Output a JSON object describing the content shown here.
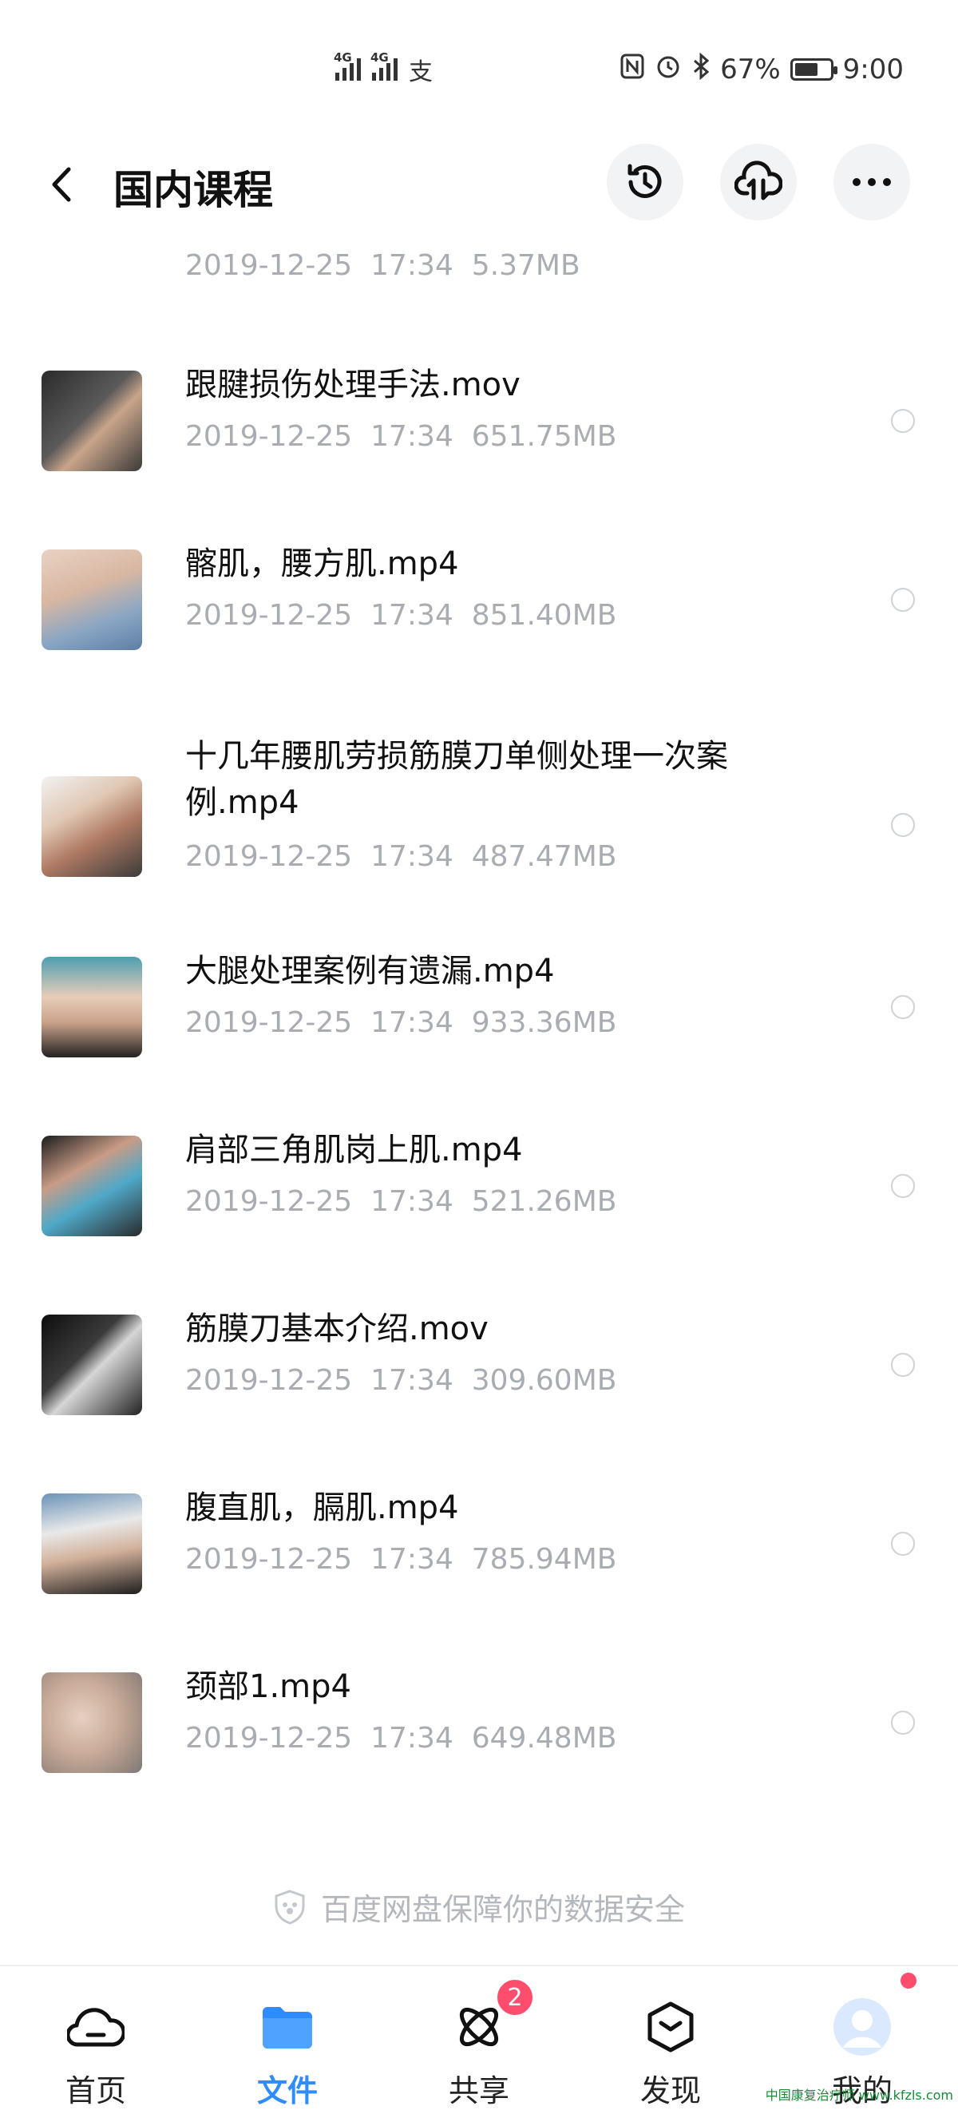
{
  "status_bar": {
    "network1": "4G",
    "network2": "4G",
    "battery_percent": "67%",
    "time": "9:00"
  },
  "header": {
    "title": "国内课程"
  },
  "files": [
    {
      "name": "",
      "date": "2019-12-25",
      "time": "17:34",
      "size": "5.37MB"
    },
    {
      "name": "跟腱损伤处理手法.mov",
      "date": "2019-12-25",
      "time": "17:34",
      "size": "651.75MB"
    },
    {
      "name": "髂肌，腰方肌.mp4",
      "date": "2019-12-25",
      "time": "17:34",
      "size": "851.40MB"
    },
    {
      "name": "十几年腰肌劳损筋膜刀单侧处理一次案例.mp4",
      "date": "2019-12-25",
      "time": "17:34",
      "size": "487.47MB"
    },
    {
      "name": "大腿处理案例有遗漏.mp4",
      "date": "2019-12-25",
      "time": "17:34",
      "size": "933.36MB"
    },
    {
      "name": "肩部三角肌岗上肌.mp4",
      "date": "2019-12-25",
      "time": "17:34",
      "size": "521.26MB"
    },
    {
      "name": "筋膜刀基本介绍.mov",
      "date": "2019-12-25",
      "time": "17:34",
      "size": "309.60MB"
    },
    {
      "name": "腹直肌，膈肌.mp4",
      "date": "2019-12-25",
      "time": "17:34",
      "size": "785.94MB"
    },
    {
      "name": "颈部1.mp4",
      "date": "2019-12-25",
      "time": "17:34",
      "size": "649.48MB"
    }
  ],
  "footer_note": "百度网盘保障你的数据安全",
  "tabbar": {
    "tabs": [
      {
        "label": "首页",
        "icon": "cloud-icon"
      },
      {
        "label": "文件",
        "icon": "folder-icon"
      },
      {
        "label": "共享",
        "icon": "atom-icon",
        "badge": "2"
      },
      {
        "label": "发现",
        "icon": "box-icon"
      },
      {
        "label": "我的",
        "icon": "avatar-icon"
      }
    ],
    "active": "文件"
  },
  "watermark": "中国康复治疗师 www.kfzls.com",
  "colors": {
    "accent": "#2f8cff",
    "badge": "#ff4d6d",
    "meta_text": "#a9acb1"
  }
}
